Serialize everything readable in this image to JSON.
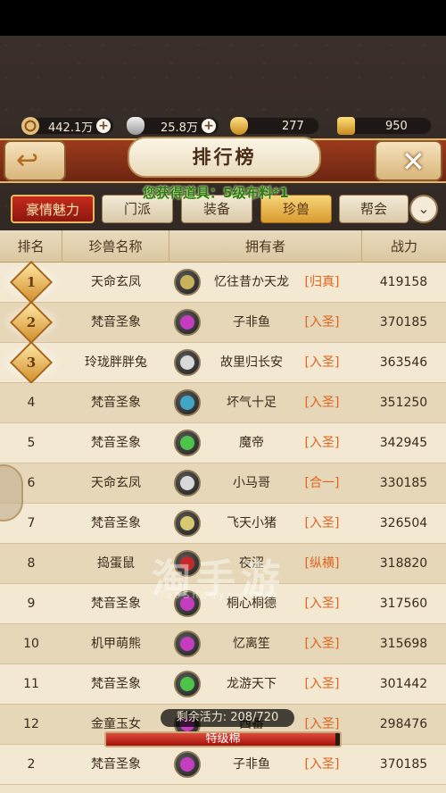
{
  "currency": {
    "coins": "442.1万",
    "silver": "25.8万",
    "gold": "277",
    "gift": "950"
  },
  "header": {
    "title": "排行榜",
    "back_icon": "back-arrow-icon",
    "close_icon": "close-x-icon"
  },
  "notice": "您获得道具：5级布料*1",
  "tabs": [
    {
      "label": "豪情魅力"
    },
    {
      "label": "门派"
    },
    {
      "label": "装备"
    },
    {
      "label": "珍兽"
    },
    {
      "label": "帮会"
    }
  ],
  "columns": [
    "排名",
    "珍兽名称",
    "拥有者",
    "战力"
  ],
  "rows": [
    {
      "rank": "1",
      "pet": "天命玄凤",
      "owner": "忆往昔か天龙",
      "faction": "[归真]",
      "power": "419158"
    },
    {
      "rank": "2",
      "pet": "梵音圣象",
      "owner": "子非鱼",
      "faction": "[入圣]",
      "power": "370185"
    },
    {
      "rank": "3",
      "pet": "玲珑胖胖兔",
      "owner": "故里归长安",
      "faction": "[入圣]",
      "power": "363546"
    },
    {
      "rank": "4",
      "pet": "梵音圣象",
      "owner": "坏气十足",
      "faction": "[入圣]",
      "power": "351250"
    },
    {
      "rank": "5",
      "pet": "梵音圣象",
      "owner": "魔帝",
      "faction": "[入圣]",
      "power": "342945"
    },
    {
      "rank": "6",
      "pet": "天命玄凤",
      "owner": "小马哥",
      "faction": "[合一]",
      "power": "330185"
    },
    {
      "rank": "7",
      "pet": "梵音圣象",
      "owner": "飞天小猪",
      "faction": "[入圣]",
      "power": "326504"
    },
    {
      "rank": "8",
      "pet": "捣蛋鼠",
      "owner": "夜涩",
      "faction": "[纵横]",
      "power": "318820"
    },
    {
      "rank": "9",
      "pet": "梵音圣象",
      "owner": "桐心桐德",
      "faction": "[入圣]",
      "power": "317560"
    },
    {
      "rank": "10",
      "pet": "机甲萌熊",
      "owner": "忆离笙",
      "faction": "[入圣]",
      "power": "315698"
    },
    {
      "rank": "11",
      "pet": "梵音圣象",
      "owner": "龙游天下",
      "faction": "[入圣]",
      "power": "301442"
    },
    {
      "rank": "12",
      "pet": "金童玉女",
      "owner": "西番",
      "faction": "[入圣]",
      "power": "298476"
    },
    {
      "rank": "2",
      "pet": "梵音圣象",
      "owner": "子非鱼",
      "faction": "[入圣]",
      "power": "370185"
    }
  ],
  "energy": {
    "label": "剩余活力:",
    "value": "208/720",
    "fraction": 0.289
  },
  "progress": {
    "label": "特级棉",
    "fraction": 0.98
  },
  "watermark": {
    "main": "淘手游",
    "sub": "TaoShouyou.com"
  },
  "colors": {
    "faction": "#e0631c",
    "tab_active": "#e7b24a",
    "header_red": "#8a2e16"
  }
}
